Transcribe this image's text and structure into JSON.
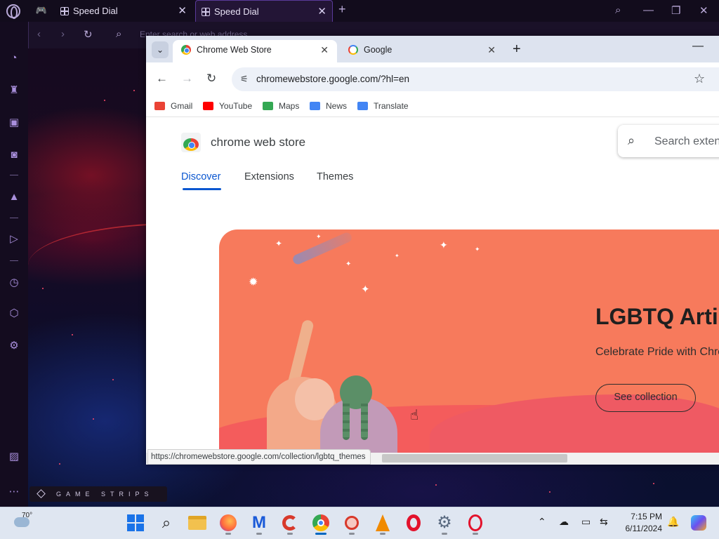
{
  "opera": {
    "tabs": [
      {
        "title": "Speed Dial"
      },
      {
        "title": "Speed Dial"
      }
    ],
    "address_placeholder": "Enter search or web address",
    "game_strips_label": "GAME STRIPS"
  },
  "chrome": {
    "tabs": [
      {
        "title": "Chrome Web Store"
      },
      {
        "title": "Google"
      }
    ],
    "url": "chromewebstore.google.com/?hl=en",
    "bookmarks": [
      {
        "label": "Gmail",
        "color": "#ea4335"
      },
      {
        "label": "YouTube",
        "color": "#ff0000"
      },
      {
        "label": "Maps",
        "color": "#34a853"
      },
      {
        "label": "News",
        "color": "#4285f4"
      },
      {
        "label": "Translate",
        "color": "#4285f4"
      }
    ],
    "status_url": "https://chromewebstore.google.com/collection/lgbtq_themes"
  },
  "store": {
    "title": "chrome web store",
    "search_placeholder": "Search extensions",
    "nav": [
      {
        "label": "Discover",
        "active": true
      },
      {
        "label": "Extensions",
        "active": false
      },
      {
        "label": "Themes",
        "active": false
      }
    ],
    "hero": {
      "title": "LGBTQ Artists",
      "subtitle": "Celebrate Pride with Chrome",
      "button": "See collection",
      "background_color": "#f77a5c"
    }
  },
  "taskbar": {
    "weather_temp": "70°",
    "time": "7:15 PM",
    "date": "6/11/2024"
  }
}
